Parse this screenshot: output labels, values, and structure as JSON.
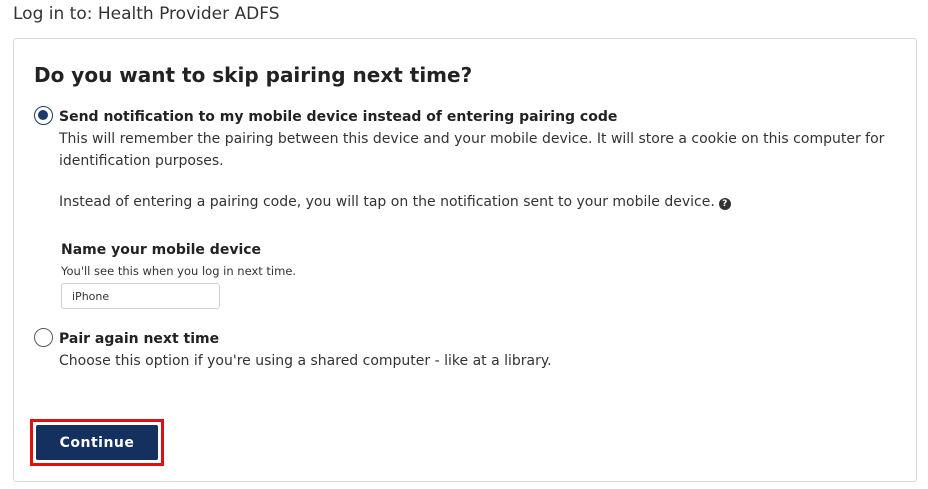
{
  "header": {
    "title": "Log in to: Health Provider ADFS"
  },
  "card": {
    "title": "Do you want to skip pairing next time?",
    "option_notify": {
      "label": "Send notification to my mobile device instead of entering pairing code",
      "desc_line1": "This will remember the pairing between this device and your mobile device. It will store a cookie on this computer for",
      "desc_line2": "identification purposes.",
      "desc_line3": "Instead of entering a pairing code, you will tap on the notification sent to your mobile device.",
      "help_glyph": "?",
      "selected": true
    },
    "device": {
      "label": "Name your mobile device",
      "hint": "You'll see this when you log in next time.",
      "value": "iPhone"
    },
    "option_pair": {
      "label": "Pair again next time",
      "desc": "Choose this option if you're using a shared computer - like at a library.",
      "selected": false
    },
    "continue_label": "Continue"
  },
  "colors": {
    "primary": "#14305f",
    "highlight": "#e01010"
  }
}
